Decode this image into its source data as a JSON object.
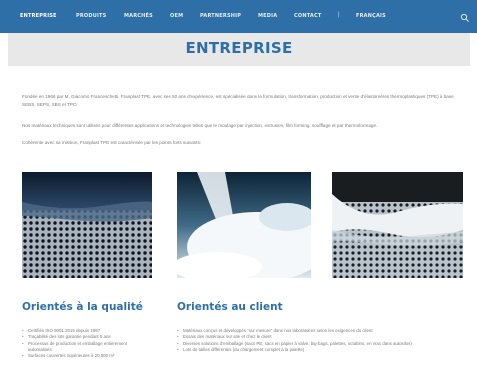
{
  "nav": {
    "items": [
      "ENTREPRISE",
      "PRODUITS",
      "MARCHÉS",
      "OEM",
      "PARTNERSHIP",
      "MEDIA",
      "CONTACT"
    ],
    "separator": "|",
    "language": "FRANÇAIS",
    "active_index": 0,
    "search_icon": "search-icon",
    "bar_color": "#2d6fa6"
  },
  "page": {
    "title": "ENTREPRISE",
    "title_color": "#2d6fa6"
  },
  "intro": {
    "p1": "Fondée en 1966 par M. Giacomo Franceschetti, Franplast TPE, avec ses 50 ans d'expérience, est spécialisée dans la formulation, transformation, production et vente d'élastomères thermoplastiques (TPE) à base SEBS, SEPS, SBS et TPO.",
    "p2": "Nos matériaux techniques sont utilisés pour différentes applications et technologies telles que le moulage par injection, extrusion, film forming, soufflage et par thermoformage.",
    "p3": "Cohérente avec sa mission, Franplast TPE est caractérisée par les points forts suivants:"
  },
  "photos": [
    "perforated-metal-with-granules",
    "white-powder-granules",
    "granules-on-perforated-sieve"
  ],
  "sections": {
    "quality": {
      "title": "Orientés à la qualité",
      "items": [
        "Certifiés ISO 9001:2015 depuis 1997",
        "Traçabilité des lots garantie pendant 5 ans",
        "Processus de production et emballage entièrement automatisés",
        "Surfaces couvertes supérieures à 20.000 m²"
      ]
    },
    "client": {
      "title": "Orientés au client",
      "items": [
        "Matériaux conçus et développés \"sur mesure\" dans nos laboratoires selon les exigences du client",
        "Essais des matériaux sur site et chez le client",
        "Diverses solutions d'emballage (sacs PE, sacs en papier à valve, big-bags, palettes, octabins, en vrac dans autosilos)",
        "Lots de tailles différentes (du chargement complet à la palette)"
      ]
    }
  }
}
